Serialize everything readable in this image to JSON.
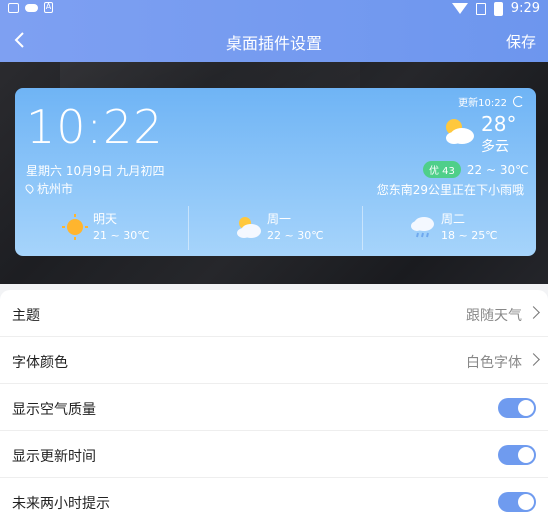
{
  "header": {
    "title": "桌面插件设置",
    "save_label": "保存",
    "time": "9:29"
  },
  "widget": {
    "update_text": "更新10:22",
    "time": "10:22",
    "date": "星期六 10月9日 九月初四",
    "city": "杭州市",
    "temp": "28°",
    "condition": "多云",
    "aqi_badge": "优 43",
    "temp_range": "22 ~ 30℃",
    "rain_tip": "您东南29公里正在下小雨哦",
    "forecast": [
      {
        "day": "明天",
        "range": "21 ~ 30℃",
        "icon": "sunny-icon"
      },
      {
        "day": "周一",
        "range": "22 ~ 30℃",
        "icon": "partly-cloudy-icon"
      },
      {
        "day": "周二",
        "range": "18 ~ 25℃",
        "icon": "rain-icon"
      }
    ]
  },
  "settings": {
    "items": [
      {
        "label": "主题",
        "value": "跟随天气",
        "type": "select"
      },
      {
        "label": "字体颜色",
        "value": "白色字体",
        "type": "select"
      },
      {
        "label": "显示空气质量",
        "type": "toggle",
        "on": true
      },
      {
        "label": "显示更新时间",
        "type": "toggle",
        "on": true
      },
      {
        "label": "未来两小时提示",
        "type": "toggle",
        "on": true
      }
    ]
  },
  "colors": {
    "accent": "#6f9bef",
    "header": "#7ea0f2",
    "aqi_good": "#4fcf8a"
  }
}
